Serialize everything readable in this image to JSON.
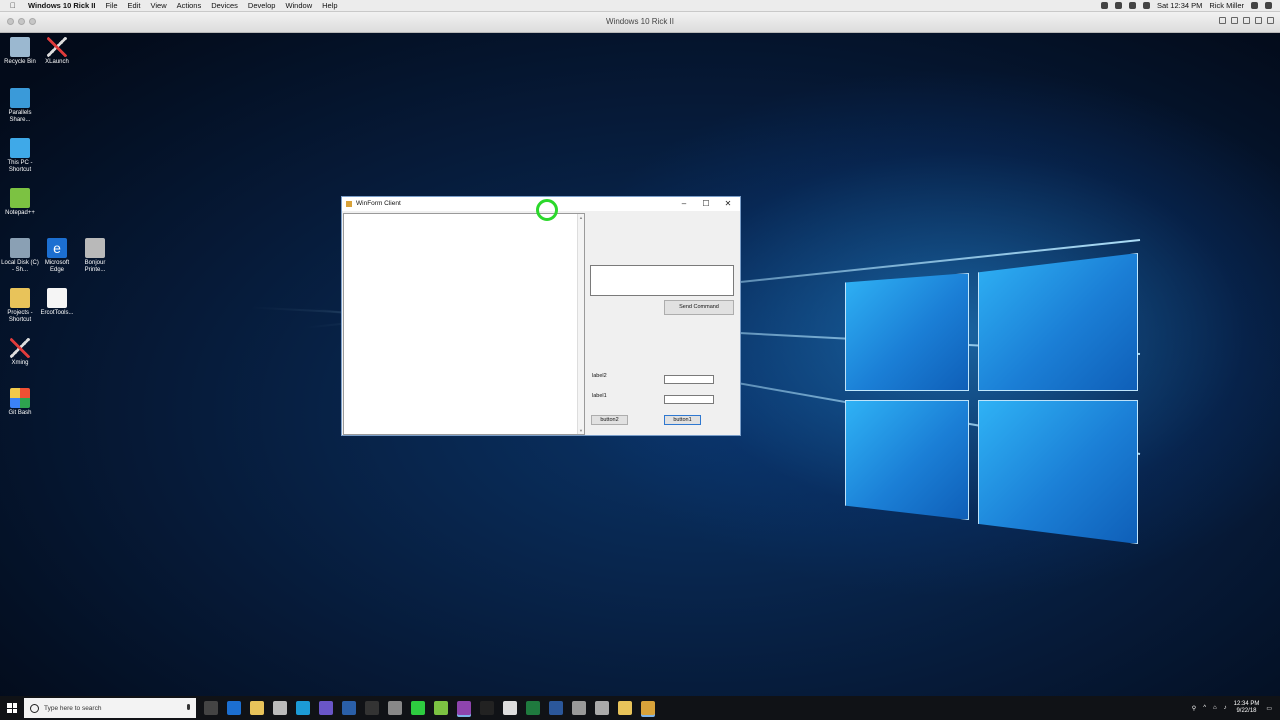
{
  "mac_menubar": {
    "app_name": "Windows 10 Rick II",
    "menus": [
      "File",
      "Edit",
      "View",
      "Actions",
      "Devices",
      "Develop",
      "Window",
      "Help"
    ],
    "clock": "Sat 12:34 PM",
    "user": "Rick Miller"
  },
  "vm_window": {
    "title": "Windows 10 Rick II"
  },
  "desktop_icons": [
    {
      "label": "Recycle Bin",
      "icon": "recycle-bin-icon"
    },
    {
      "label": "XLaunch",
      "icon": "xlaunch-icon"
    },
    {
      "label": "Parallels Share...",
      "icon": "parallels-share-icon"
    },
    {
      "label": "This PC - Shortcut",
      "icon": "this-pc-icon"
    },
    {
      "label": "Notepad++",
      "icon": "notepad-plus-plus-icon"
    },
    {
      "label": "Local Disk (C) - Sh...",
      "icon": "local-disk-icon"
    },
    {
      "label": "Microsoft Edge",
      "icon": "edge-icon"
    },
    {
      "label": "Bonjour Printe...",
      "icon": "printer-icon"
    },
    {
      "label": "Projects - Shortcut",
      "icon": "folder-icon"
    },
    {
      "label": "ErcotTools...",
      "icon": "document-icon"
    },
    {
      "label": "Xming",
      "icon": "xming-icon"
    },
    {
      "label": "Git Bash",
      "icon": "git-bash-icon"
    }
  ],
  "winform": {
    "title": "WinForm Client",
    "minimize": "–",
    "maximize": "☐",
    "close": "✕",
    "send_command_label": "Send Command",
    "label2": "label2",
    "label1": "label1",
    "button2": "button2",
    "button1": "button1",
    "command_input_value": "",
    "textbox_label2_value": "",
    "textbox_label1_value": ""
  },
  "taskbar": {
    "search_placeholder": "Type here to search",
    "time": "12:34 PM",
    "date": "9/22/18"
  },
  "colors": {
    "accent_green": "#2bd82b",
    "taskbar_bg": "#101216",
    "wallpaper_blue": "#1b7fd6"
  }
}
